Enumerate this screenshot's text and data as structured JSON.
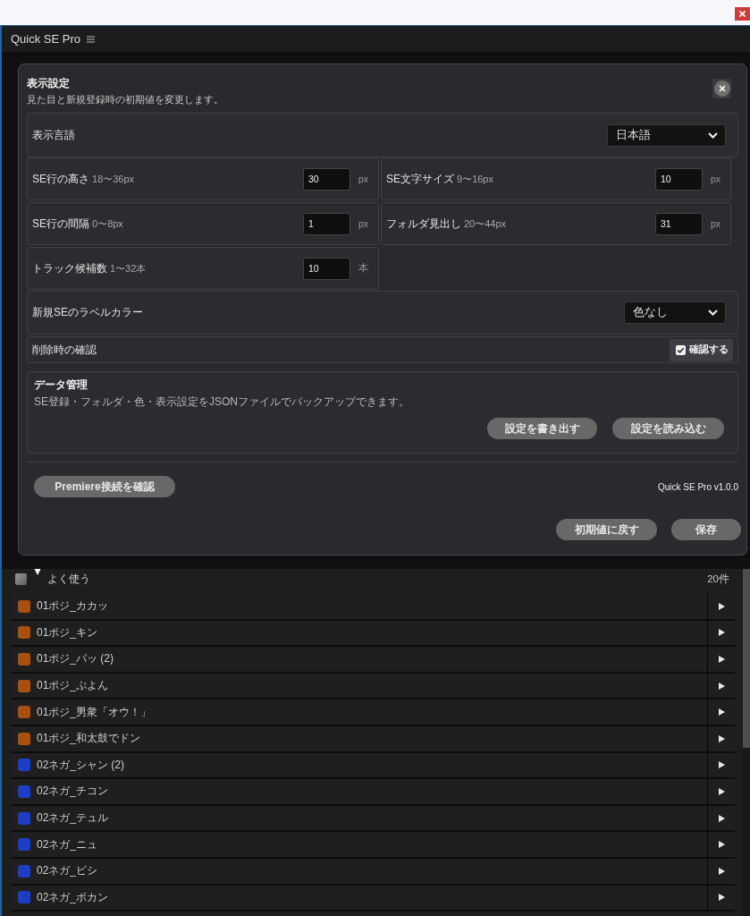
{
  "app": {
    "title": "Quick SE Pro"
  },
  "dialog": {
    "title": "表示設定",
    "subtitle": "見た目と新規登録時の初期値を変更します。",
    "language": {
      "label": "表示言語",
      "value": "日本語"
    },
    "numeric_settings": [
      {
        "label": "SE行の高さ",
        "hint": "18〜36px",
        "value": "30",
        "unit": "px"
      },
      {
        "label": "SE文字サイズ",
        "hint": "9〜16px",
        "value": "10",
        "unit": "px"
      },
      {
        "label": "SE行の間隔",
        "hint": "0〜8px",
        "value": "1",
        "unit": "px"
      },
      {
        "label": "フォルダ見出し",
        "hint": "20〜44px",
        "value": "31",
        "unit": "px"
      },
      {
        "label": "トラック候補数",
        "hint": "1〜32本",
        "value": "10",
        "unit": "本"
      }
    ],
    "label_color": {
      "label": "新規SEのラベルカラー",
      "value": "色なし"
    },
    "delete_confirm": {
      "label": "削除時の確認",
      "option": "確認する",
      "checked": true
    },
    "data_management": {
      "title": "データ管理",
      "description": "SE登録・フォルダ・色・表示設定をJSONファイルでバックアップできます。",
      "buttons": [
        "設定を書き出す",
        "設定を読み込む"
      ]
    },
    "connection_button": "Premiere接続を確認",
    "version": "Quick SE Pro v1.0.0",
    "footer_buttons": [
      "初期値に戻す",
      "保存"
    ]
  },
  "folder": {
    "name": "よく使う",
    "count": "20件",
    "expanded": true,
    "checked": false,
    "items": [
      {
        "name": "01ポジ_カカッ",
        "color": "#a8500f"
      },
      {
        "name": "01ポジ_キン",
        "color": "#a8500f"
      },
      {
        "name": "01ポジ_パッ (2)",
        "color": "#a8500f"
      },
      {
        "name": "01ポジ_ぷよん",
        "color": "#a8500f"
      },
      {
        "name": "01ポジ_男衆「オウ！」",
        "color": "#a8500f"
      },
      {
        "name": "01ポジ_和太鼓でドン",
        "color": "#a8500f"
      },
      {
        "name": "02ネガ_シャン (2)",
        "color": "#1f3cc4"
      },
      {
        "name": "02ネガ_チコン",
        "color": "#1f3cc4"
      },
      {
        "name": "02ネガ_テュル",
        "color": "#1f3cc4"
      },
      {
        "name": "02ネガ_ニュ",
        "color": "#1f3cc4"
      },
      {
        "name": "02ネガ_ビシ",
        "color": "#1f3cc4"
      },
      {
        "name": "02ネガ_ポカン",
        "color": "#1f3cc4"
      }
    ]
  }
}
